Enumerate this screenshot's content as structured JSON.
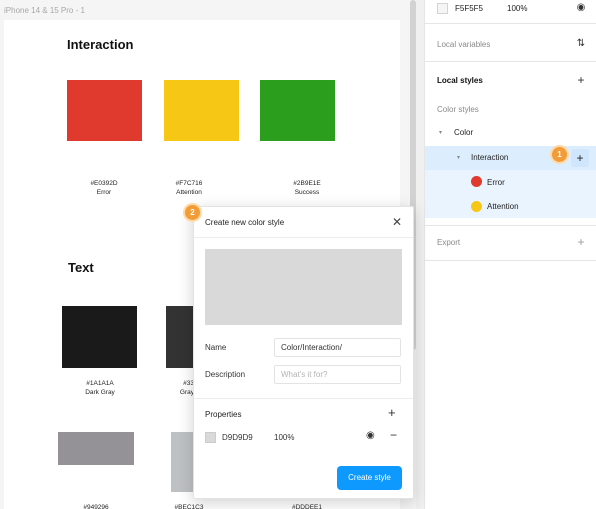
{
  "canvas": {
    "frame_label": "iPhone 14 & 15 Pro - 1",
    "interaction_heading": "Interaction",
    "text_heading": "Text",
    "swatches_interaction": [
      {
        "hex": "#E0392D",
        "name": "Error",
        "color": "#e0392d"
      },
      {
        "hex": "#F7C716",
        "name": "Attention",
        "color": "#f7c716"
      },
      {
        "hex": "#2B9E1E",
        "name": "Success",
        "color": "#2b9e1e"
      }
    ],
    "swatches_text": [
      {
        "hex": "#1A1A1A",
        "name": "Dark Gray",
        "color": "#1a1a1a"
      },
      {
        "hex": "#33",
        "name": "Gray",
        "color": "#333333"
      }
    ],
    "swatches_bottom": [
      {
        "hex": "#949296",
        "color": "#949296"
      },
      {
        "hex": "#BEC1C3",
        "color": "#bec1c3"
      },
      {
        "hex": "#DDDEE1",
        "color": "#dddee1"
      }
    ]
  },
  "panel": {
    "fill": {
      "hex": "F5F5F5",
      "opacity": "100%",
      "swatch_color": "#f5f5f5"
    },
    "local_variables": "Local variables",
    "local_styles": "Local styles",
    "color_styles": "Color styles",
    "color_group": "Color",
    "interaction_group": "Interaction",
    "styles": [
      {
        "name": "Error",
        "color": "#e0392d"
      },
      {
        "name": "Attention",
        "color": "#f7c716"
      }
    ],
    "export": "Export",
    "badge_1": "1"
  },
  "modal": {
    "badge_2": "2",
    "title": "Create new color style",
    "name_label": "Name",
    "name_value": "Color/Interaction/",
    "description_label": "Description",
    "description_placeholder": "What's it for?",
    "properties_label": "Properties",
    "prop_hex": "D9D9D9",
    "prop_opacity": "100%",
    "create_button": "Create style"
  }
}
